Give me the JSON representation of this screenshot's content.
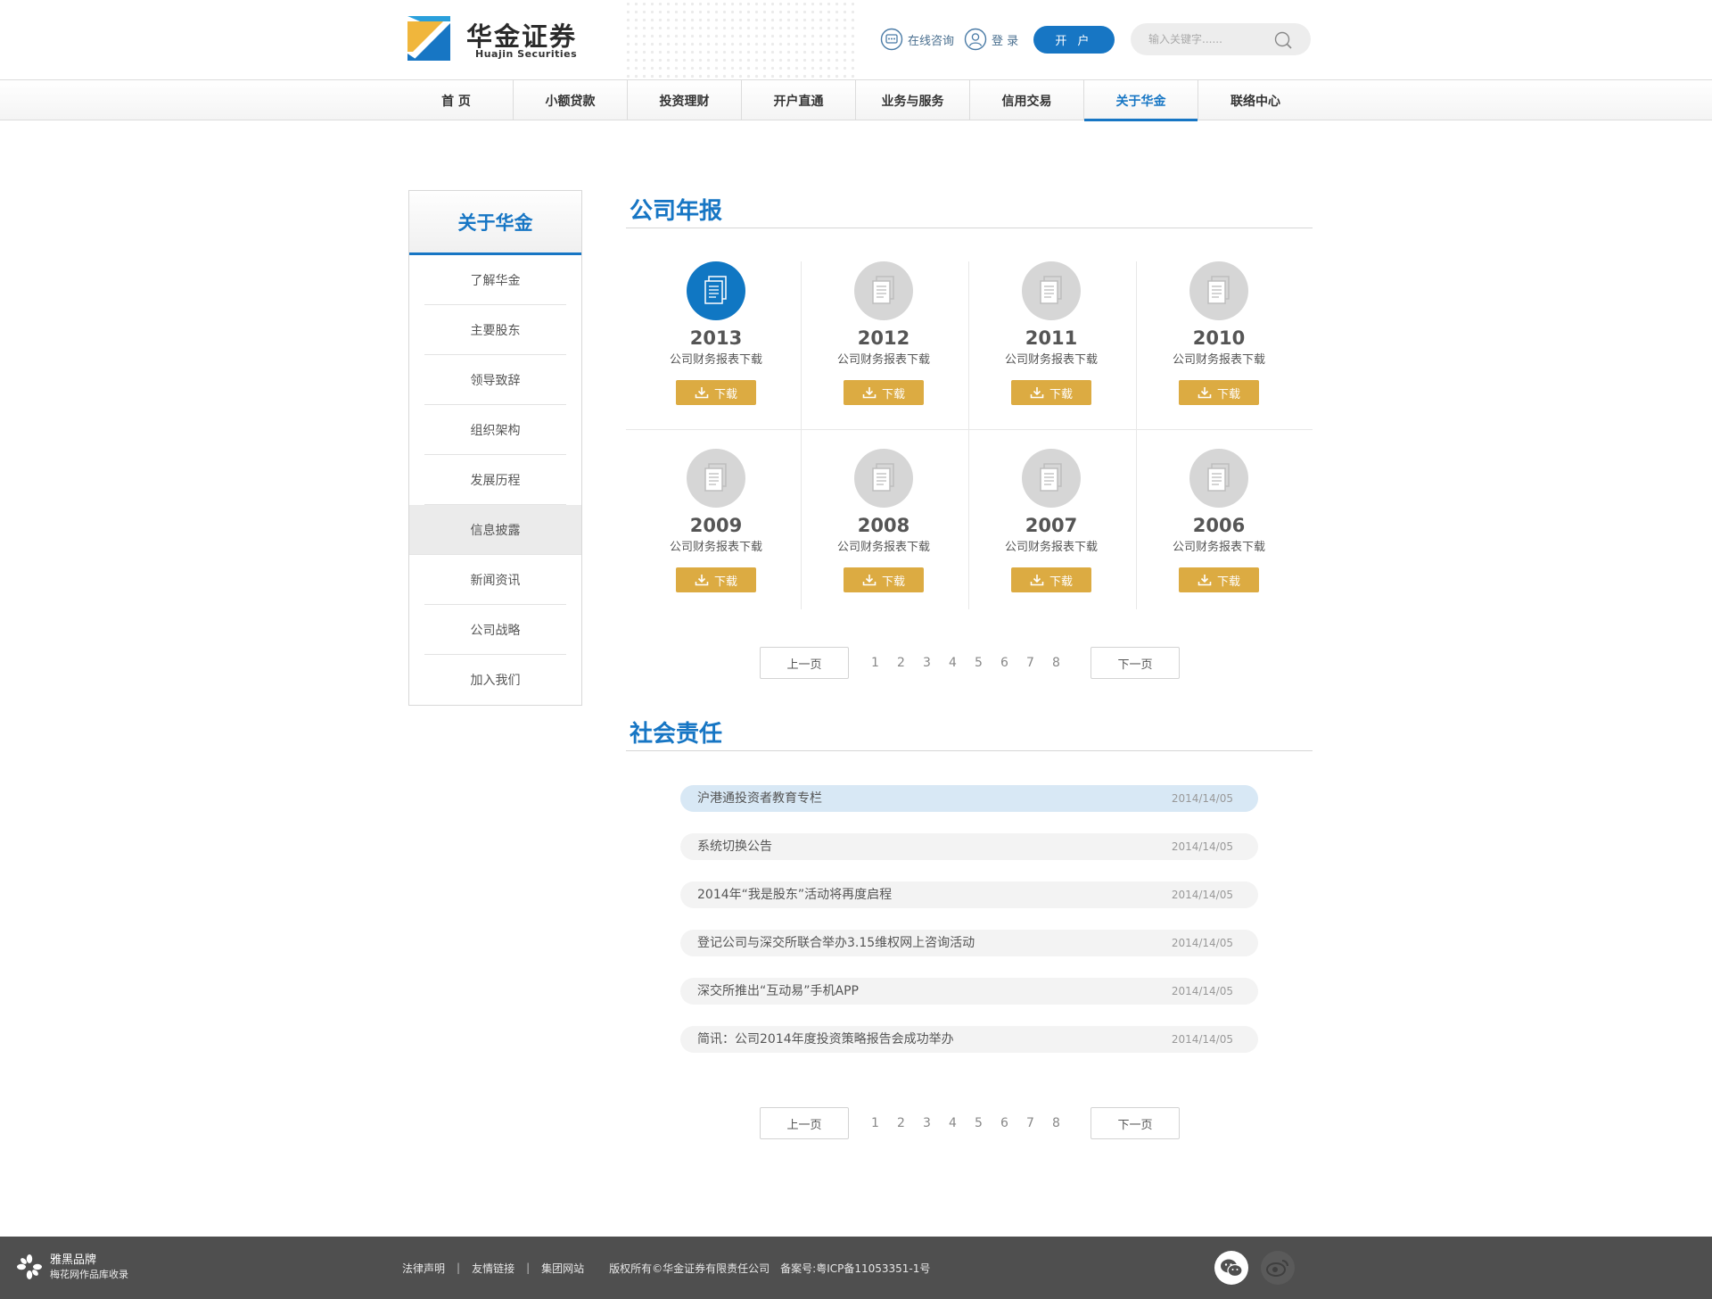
{
  "header": {
    "logo_cn": "华金证券",
    "logo_en": "Huajin Securities",
    "consult_label": "在线咨询",
    "login_label": "登 录",
    "open_account_label": "开 户",
    "search_placeholder": "输入关键字......",
    "icons": {
      "consult": "chat-icon",
      "login": "user-icon",
      "search": "search-icon"
    },
    "accent_color": "#1776c4"
  },
  "nav": {
    "items": [
      "首 页",
      "小额贷款",
      "投资理财",
      "开户直通",
      "业务与服务",
      "信用交易",
      "关于华金",
      "联络中心"
    ],
    "active": "关于华金"
  },
  "sidebar": {
    "title": "关于华金",
    "items": [
      "了解华金",
      "主要股东",
      "领导致辞",
      "组织架构",
      "发展历程",
      "信息披露",
      "新闻资讯",
      "公司战略",
      "加入我们"
    ],
    "active": "信息披露"
  },
  "annual": {
    "title": "公司年报",
    "reports": [
      {
        "year": "2013",
        "label": "公司财务报表下载",
        "button": "下载",
        "active": true
      },
      {
        "year": "2012",
        "label": "公司财务报表下载",
        "button": "下载",
        "active": false
      },
      {
        "year": "2011",
        "label": "公司财务报表下载",
        "button": "下载",
        "active": false
      },
      {
        "year": "2010",
        "label": "公司财务报表下载",
        "button": "下载",
        "active": false
      },
      {
        "year": "2009",
        "label": "公司财务报表下载",
        "button": "下载",
        "active": false
      },
      {
        "year": "2008",
        "label": "公司财务报表下载",
        "button": "下载",
        "active": false
      },
      {
        "year": "2007",
        "label": "公司财务报表下载",
        "button": "下载",
        "active": false
      },
      {
        "year": "2006",
        "label": "公司财务报表下载",
        "button": "下载",
        "active": false
      }
    ],
    "download_color": "#dcab42"
  },
  "pager": {
    "prev": "上一页",
    "next": "下一页",
    "pages": [
      "1",
      "2",
      "3",
      "4",
      "5",
      "6",
      "7",
      "8"
    ]
  },
  "social": {
    "title": "社会责任",
    "news": [
      {
        "title": "沪港通投资者教育专栏",
        "date": "2014/14/05",
        "active": true
      },
      {
        "title": "系统切换公告",
        "date": "2014/14/05",
        "active": false
      },
      {
        "title": "2014年“我是股东”活动将再度启程",
        "date": "2014/14/05",
        "active": false
      },
      {
        "title": "登记公司与深交所联合举办3.15维权网上咨询活动",
        "date": "2014/14/05",
        "active": false
      },
      {
        "title": "深交所推出“互动易”手机APP",
        "date": "2014/14/05",
        "active": false
      },
      {
        "title": "简讯：公司2014年度投资策略报告会成功举办",
        "date": "2014/14/05",
        "active": false
      }
    ]
  },
  "footer": {
    "brand_line1": "雅黑品牌",
    "brand_line2": "梅花网作品库收录",
    "links": [
      "法律声明",
      "友情链接",
      "集团网站"
    ],
    "copyright": "版权所有©华金证券有限责任公司",
    "icp": "备案号:粤ICP备11053351-1号",
    "icons": {
      "wechat": "wechat-icon",
      "weibo": "weibo-icon"
    }
  }
}
